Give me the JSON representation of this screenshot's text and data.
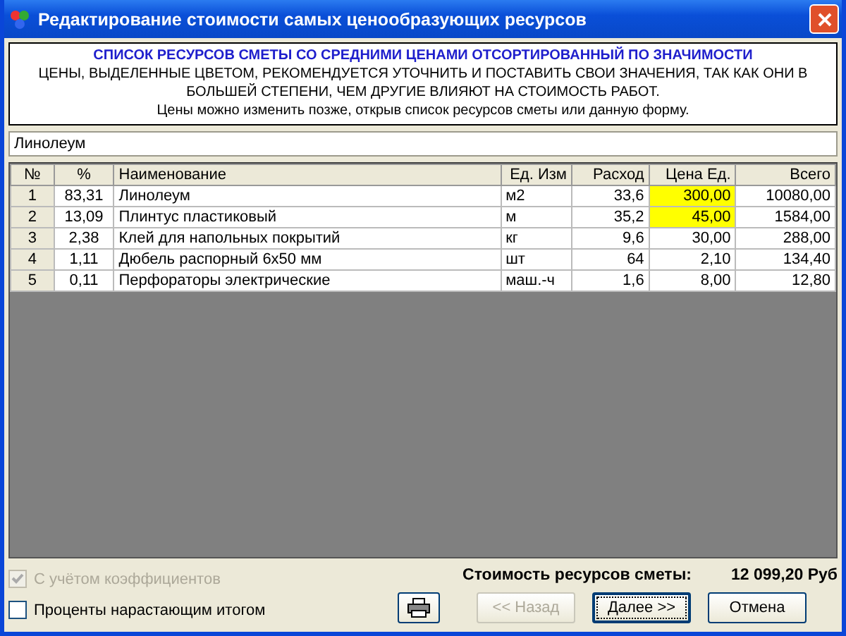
{
  "window": {
    "title": "Редактирование стоимости самых ценообразующих ресурсов"
  },
  "info": {
    "heading": "СПИСОК РЕСУРСОВ СМЕТЫ СО СРЕДНИМИ ЦЕНАМИ ОТСОРТИРОВАННЫЙ ПО ЗНАЧИМОСТИ",
    "warning": "ЦЕНЫ, ВЫДЕЛЕННЫЕ ЦВЕТОМ, РЕКОМЕНДУЕТСЯ УТОЧНИТЬ И ПОСТАВИТЬ СВОИ ЗНАЧЕНИЯ, ТАК КАК ОНИ В БОЛЬШЕЙ СТЕПЕНИ, ЧЕМ ДРУГИЕ ВЛИЯЮТ НА СТОИМОСТЬ РАБОТ.",
    "note": "Цены можно изменить позже, открыв список ресурсов сметы или данную форму."
  },
  "name_field": {
    "value": "Линолеум"
  },
  "table": {
    "columns": [
      "№",
      "%",
      "Наименование",
      "Ед. Изм",
      "Расход",
      "Цена Ед.",
      "Всего"
    ],
    "rows": [
      {
        "cells": [
          "1",
          "83,31",
          "Линолеум",
          "м2",
          "33,6",
          "300,00",
          "10080,00"
        ],
        "highlighted": true
      },
      {
        "cells": [
          "2",
          "13,09",
          "Плинтус пластиковый",
          "м",
          "35,2",
          "45,00",
          "1584,00"
        ],
        "highlighted": true
      },
      {
        "cells": [
          "3",
          "2,38",
          "Клей для напольных покрытий",
          "кг",
          "9,6",
          "30,00",
          "288,00"
        ],
        "highlighted": false
      },
      {
        "cells": [
          "4",
          "1,11",
          "Дюбель распорный 6х50 мм",
          "шт",
          "64",
          "2,10",
          "134,40"
        ],
        "highlighted": false
      },
      {
        "cells": [
          "5",
          "0,11",
          "Перфораторы электрические",
          "маш.-ч",
          "1,6",
          "8,00",
          "12,80"
        ],
        "highlighted": false
      }
    ]
  },
  "options": [
    {
      "label": "С учётом коэффициентов",
      "checked": true,
      "disabled": true
    },
    {
      "label": "Проценты нарастающим итогом",
      "checked": false,
      "disabled": false
    }
  ],
  "total": {
    "label": "Стоимость ресурсов сметы:",
    "value": "12 099,20 Руб"
  },
  "buttons": [
    {
      "kind": "icon",
      "disabled": false
    },
    {
      "kind": "text",
      "label": "<< Назад",
      "disabled": true,
      "default": false
    },
    {
      "kind": "text",
      "label": "Далее >>",
      "disabled": false,
      "default": true
    },
    {
      "kind": "text",
      "label": "Отмена",
      "disabled": false,
      "default": false
    }
  ]
}
